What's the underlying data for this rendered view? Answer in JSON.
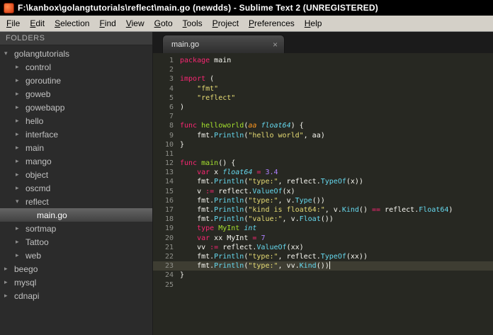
{
  "window": {
    "title": "F:\\kanbox\\golangtutorials\\reflect\\main.go (newdds) - Sublime Text 2 (UNREGISTERED)"
  },
  "menubar": {
    "items": [
      {
        "label": "File"
      },
      {
        "label": "Edit"
      },
      {
        "label": "Selection"
      },
      {
        "label": "Find"
      },
      {
        "label": "View"
      },
      {
        "label": "Goto"
      },
      {
        "label": "Tools"
      },
      {
        "label": "Project"
      },
      {
        "label": "Preferences"
      },
      {
        "label": "Help"
      }
    ]
  },
  "sidebar": {
    "header": "FOLDERS",
    "items": [
      {
        "label": "golangtutorials",
        "level": 0,
        "kind": "folder",
        "expanded": true,
        "selected": false
      },
      {
        "label": "control",
        "level": 1,
        "kind": "folder",
        "expanded": false,
        "selected": false
      },
      {
        "label": "goroutine",
        "level": 1,
        "kind": "folder",
        "expanded": false,
        "selected": false
      },
      {
        "label": "goweb",
        "level": 1,
        "kind": "folder",
        "expanded": false,
        "selected": false
      },
      {
        "label": "gowebapp",
        "level": 1,
        "kind": "folder",
        "expanded": false,
        "selected": false
      },
      {
        "label": "hello",
        "level": 1,
        "kind": "folder",
        "expanded": false,
        "selected": false
      },
      {
        "label": "interface",
        "level": 1,
        "kind": "folder",
        "expanded": false,
        "selected": false
      },
      {
        "label": "main",
        "level": 1,
        "kind": "folder",
        "expanded": false,
        "selected": false
      },
      {
        "label": "mango",
        "level": 1,
        "kind": "folder",
        "expanded": false,
        "selected": false
      },
      {
        "label": "object",
        "level": 1,
        "kind": "folder",
        "expanded": false,
        "selected": false
      },
      {
        "label": "oscmd",
        "level": 1,
        "kind": "folder",
        "expanded": false,
        "selected": false
      },
      {
        "label": "reflect",
        "level": 1,
        "kind": "folder",
        "expanded": true,
        "selected": false
      },
      {
        "label": "main.go",
        "level": 2,
        "kind": "file",
        "expanded": false,
        "selected": true
      },
      {
        "label": "sortmap",
        "level": 1,
        "kind": "folder",
        "expanded": false,
        "selected": false
      },
      {
        "label": "Tattoo",
        "level": 1,
        "kind": "folder",
        "expanded": false,
        "selected": false
      },
      {
        "label": "web",
        "level": 1,
        "kind": "folder",
        "expanded": false,
        "selected": false
      },
      {
        "label": "beego",
        "level": 0,
        "kind": "folder",
        "expanded": false,
        "selected": false
      },
      {
        "label": "mysql",
        "level": 0,
        "kind": "folder",
        "expanded": false,
        "selected": false
      },
      {
        "label": "cdnapi",
        "level": 0,
        "kind": "folder",
        "expanded": false,
        "selected": false
      }
    ]
  },
  "editor": {
    "tabs": [
      {
        "label": "main.go",
        "active": true,
        "close_glyph": "×"
      }
    ],
    "active_line": 23,
    "lines": [
      {
        "n": 1,
        "tokens": [
          [
            "kw",
            "package"
          ],
          [
            "pl",
            " main"
          ]
        ]
      },
      {
        "n": 2,
        "tokens": []
      },
      {
        "n": 3,
        "tokens": [
          [
            "kw",
            "import"
          ],
          [
            "pl",
            " ("
          ]
        ]
      },
      {
        "n": 4,
        "tokens": [
          [
            "pl",
            "    "
          ],
          [
            "st",
            "\"fmt\""
          ]
        ]
      },
      {
        "n": 5,
        "tokens": [
          [
            "pl",
            "    "
          ],
          [
            "st",
            "\"reflect\""
          ]
        ]
      },
      {
        "n": 6,
        "tokens": [
          [
            "pl",
            ")"
          ]
        ]
      },
      {
        "n": 7,
        "tokens": []
      },
      {
        "n": 8,
        "tokens": [
          [
            "kw",
            "func"
          ],
          [
            "pl",
            " "
          ],
          [
            "fn",
            "helloworld"
          ],
          [
            "pl",
            "("
          ],
          [
            "param",
            "aa"
          ],
          [
            "pl",
            " "
          ],
          [
            "ty",
            "float64"
          ],
          [
            "pl",
            ") {"
          ]
        ]
      },
      {
        "n": 9,
        "tokens": [
          [
            "pl",
            "    fmt."
          ],
          [
            "call",
            "Println"
          ],
          [
            "pl",
            "("
          ],
          [
            "st",
            "\"hello world\""
          ],
          [
            "pl",
            ", aa)"
          ]
        ]
      },
      {
        "n": 10,
        "tokens": [
          [
            "pl",
            "}"
          ]
        ]
      },
      {
        "n": 11,
        "tokens": []
      },
      {
        "n": 12,
        "tokens": [
          [
            "kw",
            "func"
          ],
          [
            "pl",
            " "
          ],
          [
            "fn",
            "main"
          ],
          [
            "pl",
            "() {"
          ]
        ]
      },
      {
        "n": 13,
        "tokens": [
          [
            "pl",
            "    "
          ],
          [
            "kw",
            "var"
          ],
          [
            "pl",
            " x "
          ],
          [
            "ty",
            "float64"
          ],
          [
            "pl",
            " "
          ],
          [
            "op",
            "="
          ],
          [
            "pl",
            " "
          ],
          [
            "nu",
            "3.4"
          ]
        ]
      },
      {
        "n": 14,
        "tokens": [
          [
            "pl",
            "    fmt."
          ],
          [
            "call",
            "Println"
          ],
          [
            "pl",
            "("
          ],
          [
            "st",
            "\"type:\""
          ],
          [
            "pl",
            ", reflect."
          ],
          [
            "call",
            "TypeOf"
          ],
          [
            "pl",
            "(x))"
          ]
        ]
      },
      {
        "n": 15,
        "tokens": [
          [
            "pl",
            "    v "
          ],
          [
            "op",
            ":="
          ],
          [
            "pl",
            " reflect."
          ],
          [
            "call",
            "ValueOf"
          ],
          [
            "pl",
            "(x)"
          ]
        ]
      },
      {
        "n": 16,
        "tokens": [
          [
            "pl",
            "    fmt."
          ],
          [
            "call",
            "Println"
          ],
          [
            "pl",
            "("
          ],
          [
            "st",
            "\"type:\""
          ],
          [
            "pl",
            ", v."
          ],
          [
            "call",
            "Type"
          ],
          [
            "pl",
            "())"
          ]
        ]
      },
      {
        "n": 17,
        "tokens": [
          [
            "pl",
            "    fmt."
          ],
          [
            "call",
            "Println"
          ],
          [
            "pl",
            "("
          ],
          [
            "st",
            "\"kind is float64:\""
          ],
          [
            "pl",
            ", v."
          ],
          [
            "call",
            "Kind"
          ],
          [
            "pl",
            "() "
          ],
          [
            "op",
            "=="
          ],
          [
            "pl",
            " reflect."
          ],
          [
            "call",
            "Float64"
          ],
          [
            "pl",
            ")"
          ]
        ]
      },
      {
        "n": 18,
        "tokens": [
          [
            "pl",
            "    fmt."
          ],
          [
            "call",
            "Println"
          ],
          [
            "pl",
            "("
          ],
          [
            "st",
            "\"value:\""
          ],
          [
            "pl",
            ", v."
          ],
          [
            "call",
            "Float"
          ],
          [
            "pl",
            "())"
          ]
        ]
      },
      {
        "n": 19,
        "tokens": [
          [
            "pl",
            "    "
          ],
          [
            "kw",
            "type"
          ],
          [
            "pl",
            " "
          ],
          [
            "fn",
            "MyInt"
          ],
          [
            "pl",
            " "
          ],
          [
            "ty",
            "int"
          ]
        ]
      },
      {
        "n": 20,
        "tokens": [
          [
            "pl",
            "    "
          ],
          [
            "kw",
            "var"
          ],
          [
            "pl",
            " xx MyInt "
          ],
          [
            "op",
            "="
          ],
          [
            "pl",
            " "
          ],
          [
            "nu",
            "7"
          ]
        ]
      },
      {
        "n": 21,
        "tokens": [
          [
            "pl",
            "    vv "
          ],
          [
            "op",
            ":="
          ],
          [
            "pl",
            " reflect."
          ],
          [
            "call",
            "ValueOf"
          ],
          [
            "pl",
            "(xx)"
          ]
        ]
      },
      {
        "n": 22,
        "tokens": [
          [
            "pl",
            "    fmt."
          ],
          [
            "call",
            "Println"
          ],
          [
            "pl",
            "("
          ],
          [
            "st",
            "\"type:\""
          ],
          [
            "pl",
            ", reflect."
          ],
          [
            "call",
            "TypeOf"
          ],
          [
            "pl",
            "(xx))"
          ]
        ]
      },
      {
        "n": 23,
        "caret": true,
        "tokens": [
          [
            "pl",
            "    fmt."
          ],
          [
            "call",
            "Println"
          ],
          [
            "pl",
            "("
          ],
          [
            "st",
            "\"type:\""
          ],
          [
            "pl",
            ", vv."
          ],
          [
            "call",
            "Kind"
          ],
          [
            "pl",
            "())"
          ]
        ]
      },
      {
        "n": 24,
        "tokens": [
          [
            "pl",
            "}"
          ]
        ]
      },
      {
        "n": 25,
        "tokens": []
      }
    ]
  },
  "theme": {
    "editor_bg": "#272822",
    "current_line_bg": "#3e3d32",
    "gutter_fg": "#8f908a",
    "sidebar_bg": "#2b2b2b",
    "titlebar_bg": "#000000",
    "menubar_bg": "#d4d0c8",
    "tokens": {
      "kw": "#f92672",
      "op": "#f92672",
      "fn": "#a6e22e",
      "call": "#66d9ef",
      "ty": "#66d9ef",
      "param": "#fd971f",
      "st": "#e6db74",
      "nu": "#ae81ff",
      "pl": "#f8f8f2"
    },
    "italic_tokens": [
      "ty",
      "param"
    ]
  }
}
